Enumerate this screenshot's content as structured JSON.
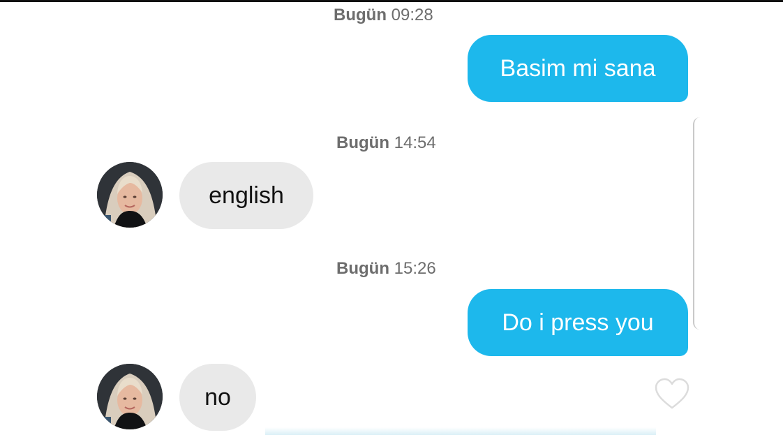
{
  "conversation": {
    "messages": [
      {
        "day": "Bugün",
        "time": "09:28",
        "text": "Basim mi sana",
        "direction": "outgoing"
      },
      {
        "day": "Bugün",
        "time": "14:54",
        "text": "english",
        "direction": "incoming"
      },
      {
        "day": "Bugün",
        "time": "15:26",
        "text": "Do i press you",
        "direction": "outgoing"
      },
      {
        "text": "no",
        "direction": "incoming"
      }
    ]
  },
  "icons": {
    "avatar": "profile-photo-avatar",
    "like": "heart-outline-icon"
  },
  "colors": {
    "outgoing_bubble": "#1db8ec",
    "incoming_bubble": "#e9e9e9",
    "timestamp_text": "#6d6d6d",
    "heart_outline": "#dcdcdc"
  }
}
